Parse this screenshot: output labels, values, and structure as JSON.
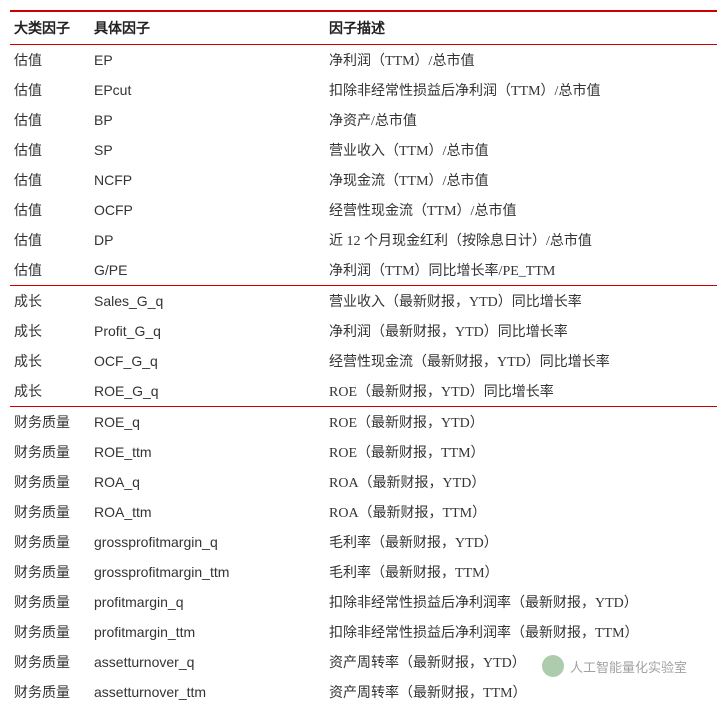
{
  "headers": {
    "col1": "大类因子",
    "col2": "具体因子",
    "col3": "因子描述"
  },
  "groups": [
    {
      "rows": [
        {
          "cat": "估值",
          "factor": "EP",
          "desc": "净利润（TTM）/总市值"
        },
        {
          "cat": "估值",
          "factor": "EPcut",
          "desc": "扣除非经常性损益后净利润（TTM）/总市值"
        },
        {
          "cat": "估值",
          "factor": "BP",
          "desc": "净资产/总市值"
        },
        {
          "cat": "估值",
          "factor": "SP",
          "desc": "营业收入（TTM）/总市值"
        },
        {
          "cat": "估值",
          "factor": "NCFP",
          "desc": "净现金流（TTM）/总市值"
        },
        {
          "cat": "估值",
          "factor": "OCFP",
          "desc": "经营性现金流（TTM）/总市值"
        },
        {
          "cat": "估值",
          "factor": "DP",
          "desc": "近 12 个月现金红利（按除息日计）/总市值"
        },
        {
          "cat": "估值",
          "factor": "G/PE",
          "desc": "净利润（TTM）同比增长率/PE_TTM"
        }
      ]
    },
    {
      "rows": [
        {
          "cat": "成长",
          "factor": "Sales_G_q",
          "desc": "营业收入（最新财报，YTD）同比增长率"
        },
        {
          "cat": "成长",
          "factor": "Profit_G_q",
          "desc": "净利润（最新财报，YTD）同比增长率"
        },
        {
          "cat": "成长",
          "factor": "OCF_G_q",
          "desc": "经营性现金流（最新财报，YTD）同比增长率"
        },
        {
          "cat": "成长",
          "factor": "ROE_G_q",
          "desc": "ROE（最新财报，YTD）同比增长率"
        }
      ]
    },
    {
      "rows": [
        {
          "cat": "财务质量",
          "factor": "ROE_q",
          "desc": "ROE（最新财报，YTD）"
        },
        {
          "cat": "财务质量",
          "factor": "ROE_ttm",
          "desc": "ROE（最新财报，TTM）"
        },
        {
          "cat": "财务质量",
          "factor": "ROA_q",
          "desc": "ROA（最新财报，YTD）"
        },
        {
          "cat": "财务质量",
          "factor": "ROA_ttm",
          "desc": "ROA（最新财报，TTM）"
        },
        {
          "cat": "财务质量",
          "factor": "grossprofitmargin_q",
          "desc": "毛利率（最新财报，YTD）"
        },
        {
          "cat": "财务质量",
          "factor": "grossprofitmargin_ttm",
          "desc": "毛利率（最新财报，TTM）"
        },
        {
          "cat": "财务质量",
          "factor": "profitmargin_q",
          "desc": "扣除非经常性损益后净利润率（最新财报，YTD）"
        },
        {
          "cat": "财务质量",
          "factor": "profitmargin_ttm",
          "desc": "扣除非经常性损益后净利润率（最新财报，TTM）"
        },
        {
          "cat": "财务质量",
          "factor": "assetturnover_q",
          "desc": "资产周转率（最新财报，YTD）"
        },
        {
          "cat": "财务质量",
          "factor": "assetturnover_ttm",
          "desc": "资产周转率（最新财报，TTM）"
        }
      ]
    }
  ],
  "watermark": "人工智能量化实验室",
  "chart_data": {
    "type": "table",
    "title": "",
    "columns": [
      "大类因子",
      "具体因子",
      "因子描述"
    ],
    "rows": [
      [
        "估值",
        "EP",
        "净利润（TTM）/总市值"
      ],
      [
        "估值",
        "EPcut",
        "扣除非经常性损益后净利润（TTM）/总市值"
      ],
      [
        "估值",
        "BP",
        "净资产/总市值"
      ],
      [
        "估值",
        "SP",
        "营业收入（TTM）/总市值"
      ],
      [
        "估值",
        "NCFP",
        "净现金流（TTM）/总市值"
      ],
      [
        "估值",
        "OCFP",
        "经营性现金流（TTM）/总市值"
      ],
      [
        "估值",
        "DP",
        "近 12 个月现金红利（按除息日计）/总市值"
      ],
      [
        "估值",
        "G/PE",
        "净利润（TTM）同比增长率/PE_TTM"
      ],
      [
        "成长",
        "Sales_G_q",
        "营业收入（最新财报，YTD）同比增长率"
      ],
      [
        "成长",
        "Profit_G_q",
        "净利润（最新财报，YTD）同比增长率"
      ],
      [
        "成长",
        "OCF_G_q",
        "经营性现金流（最新财报，YTD）同比增长率"
      ],
      [
        "成长",
        "ROE_G_q",
        "ROE（最新财报，YTD）同比增长率"
      ],
      [
        "财务质量",
        "ROE_q",
        "ROE（最新财报，YTD）"
      ],
      [
        "财务质量",
        "ROE_ttm",
        "ROE（最新财报，TTM）"
      ],
      [
        "财务质量",
        "ROA_q",
        "ROA（最新财报，YTD）"
      ],
      [
        "财务质量",
        "ROA_ttm",
        "ROA（最新财报，TTM）"
      ],
      [
        "财务质量",
        "grossprofitmargin_q",
        "毛利率（最新财报，YTD）"
      ],
      [
        "财务质量",
        "grossprofitmargin_ttm",
        "毛利率（最新财报，TTM）"
      ],
      [
        "财务质量",
        "profitmargin_q",
        "扣除非经常性损益后净利润率（最新财报，YTD）"
      ],
      [
        "财务质量",
        "profitmargin_ttm",
        "扣除非经常性损益后净利润率（最新财报，TTM）"
      ],
      [
        "财务质量",
        "assetturnover_q",
        "资产周转率（最新财报，YTD）"
      ],
      [
        "财务质量",
        "assetturnover_ttm",
        "资产周转率（最新财报，TTM）"
      ]
    ]
  }
}
